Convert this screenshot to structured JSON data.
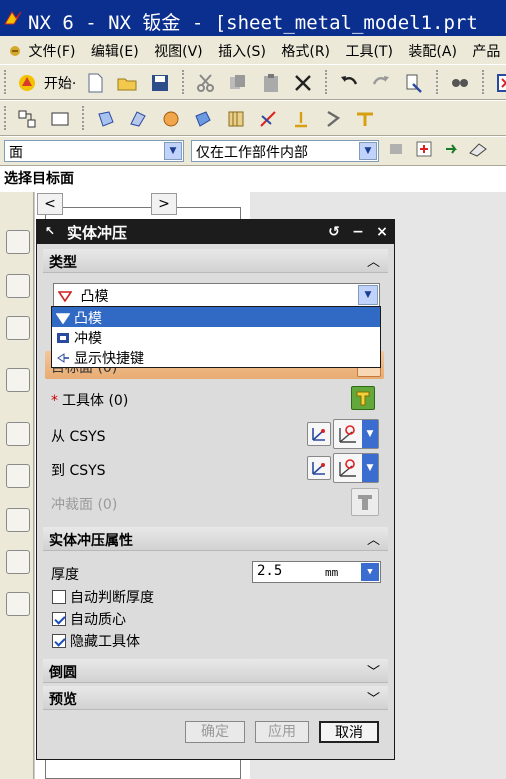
{
  "window": {
    "title": "NX 6 - NX 钣金 - [sheet_metal_model1.prt"
  },
  "menubar": {
    "items": [
      "文件(F)",
      "编辑(E)",
      "视图(V)",
      "插入(S)",
      "格式(R)",
      "工具(T)",
      "装配(A)",
      "产品"
    ]
  },
  "toolbar": {
    "start_label": "开始·"
  },
  "filters": {
    "type_filter": "面",
    "scope_filter": "仅在工作部件内部"
  },
  "status": {
    "prompt": "选择目标面"
  },
  "nav": {
    "back": "<",
    "forward": ">"
  },
  "dialog": {
    "title": "实体冲压",
    "reset_glyph": "↺",
    "minimize_glyph": "−",
    "close_glyph": "×",
    "type_section": {
      "header": "类型",
      "selected": "凸模",
      "options": [
        "凸模",
        "冲模",
        "显示快捷键"
      ]
    },
    "target_face_label": "目标面 (0)",
    "tool_body": {
      "required_mark": "*",
      "label": "工具体 (0)"
    },
    "from_csys_label": "从 CSYS",
    "to_csys_label": "到 CSYS",
    "punch_face_label": "冲裁面 (0)",
    "properties_section": {
      "header": "实体冲压属性",
      "thickness_label": "厚度",
      "thickness_value": "2.5",
      "thickness_unit": "mm",
      "auto_thickness_label": "自动判断厚度",
      "auto_thickness_checked": false,
      "auto_centroid_label": "自动质心",
      "auto_centroid_checked": true,
      "hide_tool_label": "隐藏工具体",
      "hide_tool_checked": true
    },
    "fillet_section": {
      "header": "倒圆"
    },
    "preview_section": {
      "header": "预览"
    },
    "buttons": {
      "ok": "确定",
      "apply": "应用",
      "cancel": "取消"
    }
  },
  "colors": {
    "title_bar": "#0b2f8f",
    "dialog_title": "#1c1c1c",
    "selection_highlight": "#316ac5",
    "active_row": "#e8ac72",
    "required_mark": "#cc0000"
  },
  "icons": [
    "nx-app-icon",
    "new-file-icon",
    "open-folder-icon",
    "save-icon",
    "cut-icon",
    "copy-icon",
    "paste-icon",
    "delete-icon",
    "undo-icon",
    "redo-icon",
    "punch-icon",
    "die-icon",
    "shortcut-icon",
    "csys-icon",
    "tool-body-icon"
  ]
}
